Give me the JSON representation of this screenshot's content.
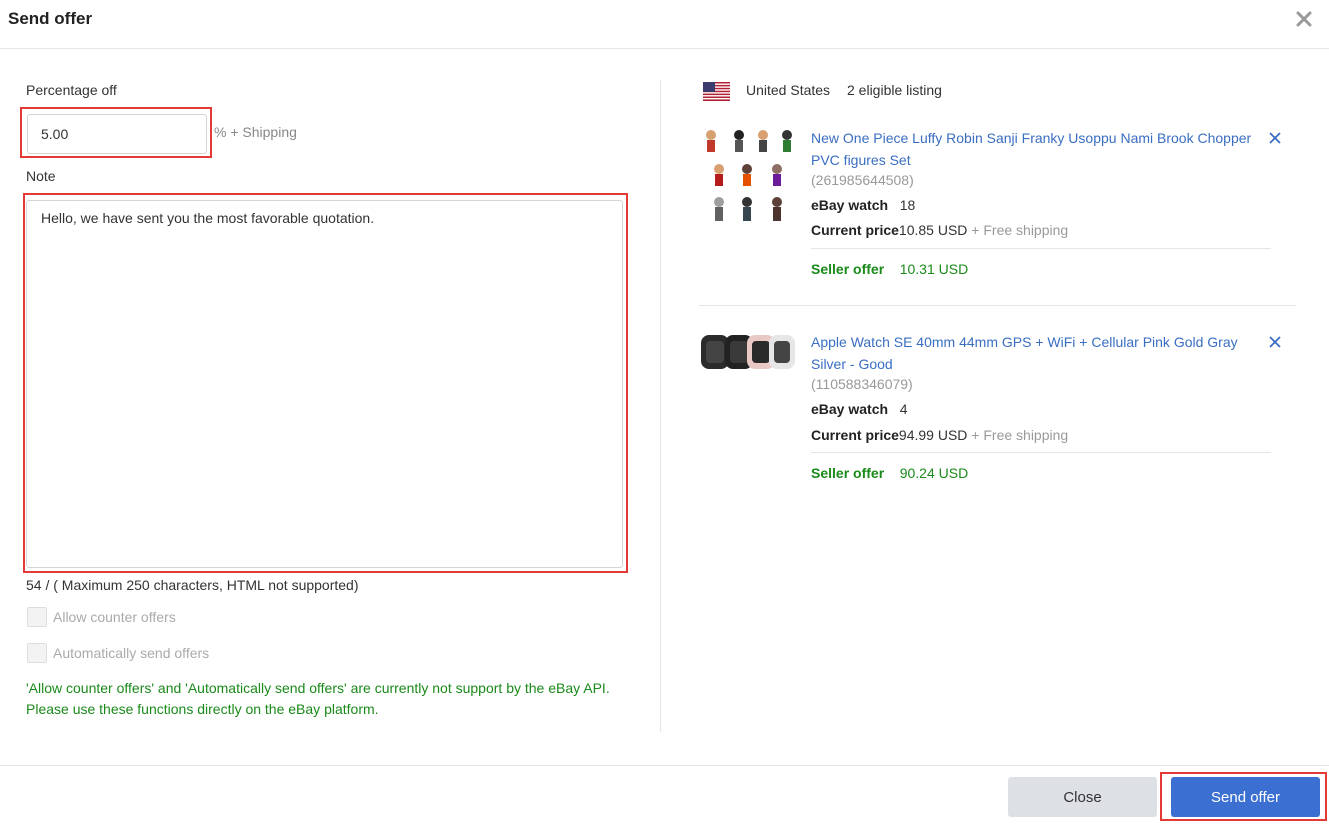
{
  "dialog": {
    "title": "Send offer"
  },
  "form": {
    "percentage_label": "Percentage off",
    "percentage_value": "5.00",
    "percentage_suffix": "% + Shipping",
    "note_label": "Note",
    "note_value": "Hello, we have sent you the most favorable quotation.",
    "char_count": "54 / ( Maximum 250 characters, HTML not supported)",
    "allow_counter_label": "Allow counter offers",
    "auto_send_label": "Automatically send offers",
    "warning": "'Allow counter offers' and 'Automatically send offers' are currently not support by the eBay API. Please use these functions directly on the eBay platform."
  },
  "listings": {
    "country": "United States",
    "eligible_count": "2 eligible listing",
    "items": [
      {
        "title": "New One Piece Luffy Robin Sanji Franky Usoppu Nami Brook Chopper PVC figures Set",
        "id": "(261985644508)",
        "watch_label": "eBay watch",
        "watch_value": "18",
        "price_label": "Current price",
        "price_value": "10.85 USD",
        "shipping": "+ Free shipping",
        "offer_label": "Seller offer",
        "offer_value": "10.31 USD"
      },
      {
        "title": "Apple Watch SE 40mm 44mm GPS + WiFi + Cellular Pink Gold Gray Silver - Good",
        "id": "(110588346079)",
        "watch_label": "eBay watch",
        "watch_value": "4",
        "price_label": "Current price",
        "price_value": "94.99 USD",
        "shipping": "+ Free shipping",
        "offer_label": "Seller offer",
        "offer_value": "90.24 USD"
      }
    ]
  },
  "footer": {
    "close_label": "Close",
    "send_label": "Send offer"
  },
  "colors": {
    "accent": "#3b6fd1",
    "link": "#3a6ec2",
    "success": "#1a8a1a",
    "highlight": "#e53935"
  }
}
